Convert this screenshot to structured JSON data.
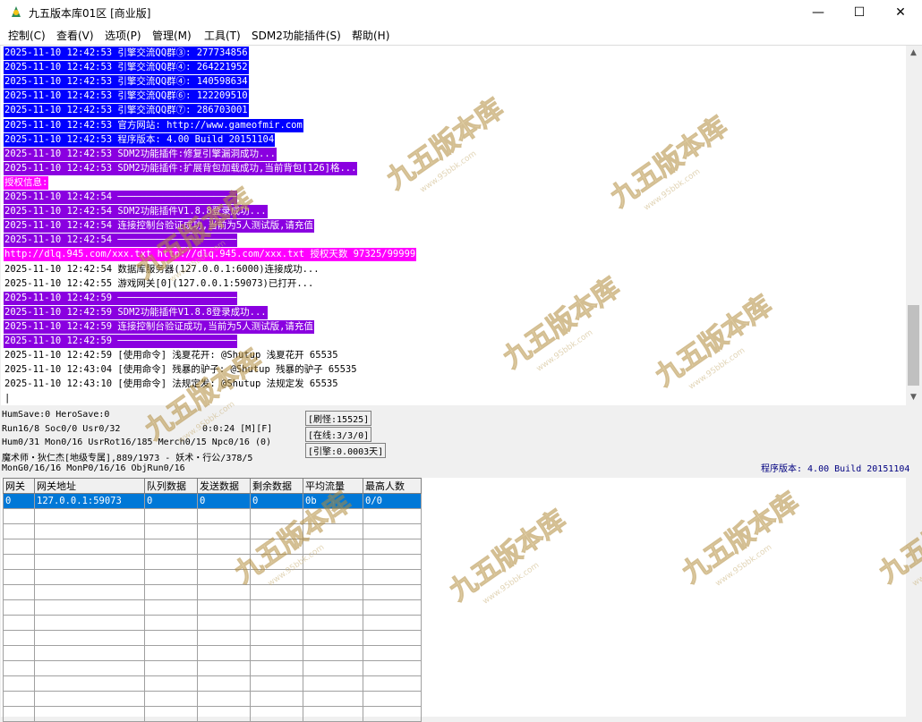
{
  "window": {
    "title": "九五版本库01区 [商业版]"
  },
  "menu": [
    "控制(C)",
    "查看(V)",
    "选项(P)",
    "管理(M)",
    "工具(T)",
    "SDM2功能插件(S)",
    "帮助(H)"
  ],
  "log": [
    {
      "text": "2025-11-10 12:42:53 引擎交流QQ群③: 277734856",
      "color": "#0000ff",
      "fg": "#ffffff"
    },
    {
      "text": "2025-11-10 12:42:53 引擎交流QQ群④: 264221952",
      "color": "#0000ff",
      "fg": "#ffffff"
    },
    {
      "text": "2025-11-10 12:42:53 引擎交流QQ群④: 140598634",
      "color": "#0000ff",
      "fg": "#ffffff"
    },
    {
      "text": "2025-11-10 12:42:53 引擎交流QQ群⑥: 122209510",
      "color": "#0000ff",
      "fg": "#ffffff"
    },
    {
      "text": "2025-11-10 12:42:53 引擎交流QQ群⑦: 286703001",
      "color": "#0000ff",
      "fg": "#ffffff"
    },
    {
      "text": "2025-11-10 12:42:53 官方网站: http://www.gameofmir.com",
      "color": "#0000ff",
      "fg": "#ffffff"
    },
    {
      "text": "2025-11-10 12:42:53 程序版本: 4.00 Build 20151104",
      "color": "#0000ff",
      "fg": "#ffffff"
    },
    {
      "text": "2025-11-10 12:42:53 SDM2功能插件:修复引擎漏洞成功...",
      "color": "#8a00e0",
      "fg": "#ffffff"
    },
    {
      "text": "2025-11-10 12:42:53 SDM2功能插件:扩展背包加载成功,当前背包[126]格...",
      "color": "#8a00e0",
      "fg": "#ffffff"
    },
    {
      "text": "授权信息:",
      "color": "#ff00ff",
      "fg": "#ffffff"
    },
    {
      "text": "2025-11-10 12:42:54 ─────────────────────",
      "color": "#8a00e0",
      "fg": "#ffffff"
    },
    {
      "text": "2025-11-10 12:42:54 SDM2功能插件V1.8.8登录成功...",
      "color": "#8a00e0",
      "fg": "#ffffff"
    },
    {
      "text": "2025-11-10 12:42:54 连接控制台验证成功,当前为5人测试版,请充值",
      "color": "#8a00e0",
      "fg": "#ffffff"
    },
    {
      "text": "2025-11-10 12:42:54 ─────────────────────",
      "color": "#8a00e0",
      "fg": "#ffffff"
    },
    {
      "text": "http://dlq.945.com/xxx.txt http://dlq.945.com/xxx.txt 授权天数 97325/99999",
      "color": "#ff00ff",
      "fg": "#ffffff"
    },
    {
      "text": "2025-11-10 12:42:54 数据库服务器(127.0.0.1:6000)连接成功...",
      "color": "",
      "fg": "#000000"
    },
    {
      "text": "2025-11-10 12:42:55 游戏网关[0](127.0.0.1:59073)已打开...",
      "color": "",
      "fg": "#000000"
    },
    {
      "text": "2025-11-10 12:42:59 ─────────────────────",
      "color": "#8a00e0",
      "fg": "#ffffff"
    },
    {
      "text": "2025-11-10 12:42:59 SDM2功能插件V1.8.8登录成功...",
      "color": "#8a00e0",
      "fg": "#ffffff"
    },
    {
      "text": "2025-11-10 12:42:59 连接控制台验证成功,当前为5人测试版,请充值",
      "color": "#8a00e0",
      "fg": "#ffffff"
    },
    {
      "text": "2025-11-10 12:42:59 ─────────────────────",
      "color": "#8a00e0",
      "fg": "#ffffff"
    },
    {
      "text": "2025-11-10 12:42:59 [使用命令] 浅夏花开: @Shutup 浅夏花开 65535",
      "color": "",
      "fg": "#000000"
    },
    {
      "text": "2025-11-10 12:43:04 [使用命令] 残暴的驴子: @Shutup 残暴的驴子 65535",
      "color": "",
      "fg": "#000000"
    },
    {
      "text": "2025-11-10 12:43:10 [使用命令] 法规定发: @Shutup 法规定发 65535",
      "color": "",
      "fg": "#000000"
    }
  ],
  "status": {
    "line1": "HumSave:0 HeroSave:0",
    "line2": "Run16/8 Soc0/0 Usr0/32",
    "time": "0:0:24 [M][F]",
    "line3": "Hum0/31 Mon0/16 UsrRot16/185 Merch0/15 Npc0/16 (0)",
    "line4": "魔术师・狄仁杰[地级专属],889/1973 - 妖术・行公/378/5",
    "line5": "MonG0/16/16 MonP0/16/16 ObjRun0/16",
    "refresh": "[刷怪:15525]",
    "online": "[在线:3/3/0]",
    "engine": "[引擎:0.0003天]",
    "version": "程序版本: 4.00 Build 20151104"
  },
  "gateway_table": {
    "headers": [
      "网关",
      "网关地址",
      "队列数据",
      "发送数据",
      "剩余数据",
      "平均流量",
      "最高人数"
    ],
    "rows": [
      [
        "0",
        "127.0.0.1:59073",
        "0",
        "0",
        "0",
        "0b",
        "0/0"
      ]
    ]
  },
  "watermark": {
    "logo": "九五版本库",
    "url": "www.95bbk.com"
  }
}
